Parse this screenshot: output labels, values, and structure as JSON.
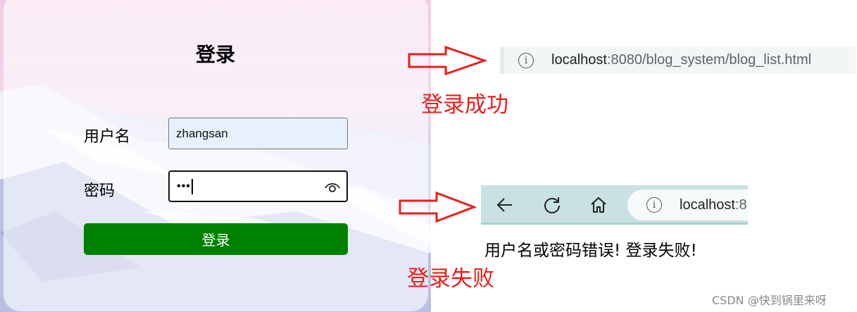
{
  "login": {
    "title": "登录",
    "username_label": "用户名",
    "username_value": "zhangsan",
    "password_label": "密码",
    "password_masked": "•••",
    "submit_label": "登录"
  },
  "success": {
    "url_host": "localhost",
    "url_path": ":8080/blog_system/blog_list.html",
    "caption": "登录成功"
  },
  "failure": {
    "url_host": "localhost",
    "url_path": ":8",
    "message": "用户名或密码错误! 登录失败!",
    "caption": "登录失败"
  },
  "watermark": "CSDN @快到锅里来呀",
  "icons": [
    "eye-icon",
    "info-icon",
    "back-arrow-icon",
    "reload-icon",
    "home-icon",
    "right-arrow-icon"
  ],
  "colors": {
    "submit_button": "#008000",
    "annotation_red": "#e8201c",
    "autofill_input": "#e8f0fe",
    "browser_toolbar": "#c9e1e2"
  }
}
